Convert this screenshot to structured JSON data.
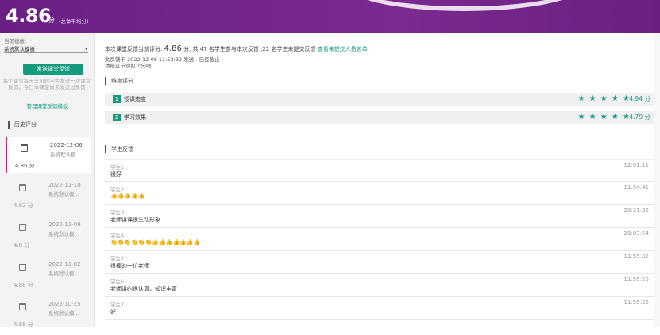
{
  "header": {
    "score": "4.86",
    "unit": "分",
    "subtitle": "(总体平均分)"
  },
  "sidebar": {
    "template_label": "当前模板:",
    "template_value": "系统默认模板",
    "send_button": "发送课堂反馈",
    "hint": "每个课堂每天只可给学生发送一次课堂反馈，今日本课堂尚未发送过反馈",
    "manage_link": "管理课堂反馈模板",
    "history_title": "历史评分",
    "history": [
      {
        "date": "2022-12-06",
        "template": "系统默认模...",
        "score": "4.86 分",
        "active": true
      },
      {
        "date": "2022-11-10",
        "template": "系统默认模...",
        "score": "4.82 分",
        "active": false
      },
      {
        "date": "2022-11-09",
        "template": "系统默认模...",
        "score": "4.8 分",
        "active": false
      },
      {
        "date": "2022-11-02",
        "template": "系统默认模...",
        "score": "4.88 分",
        "active": false
      },
      {
        "date": "2022-10-25",
        "template": "系统默认模...",
        "score": "4.88 分",
        "active": false
      }
    ]
  },
  "main": {
    "summary_prefix": "本次课堂反馈当前评分:",
    "summary_score": "4.86",
    "summary_suffix": "分, 共 47 名学生参与本次反馈 ,22 名学生未提交反馈",
    "view_link": "查看未提交人员名单",
    "sent_line1": "此反馈于 2022-12-06 11:53:32 发送，已经截止",
    "sent_line2": "请给这节课打个分吧",
    "dim_title": "维度评分",
    "dimensions": [
      {
        "no": "1",
        "name": "授课态度",
        "stars": "★ ★ ★ ★ ★",
        "value": "4.94 分"
      },
      {
        "no": "2",
        "name": "学习效果",
        "stars": "★ ★ ★ ★ ★",
        "value": "4.79 分"
      }
    ],
    "feedback_title": "学生反馈",
    "feedback": [
      {
        "who": "学生1 :",
        "text": "很好",
        "time": "12:01:11"
      },
      {
        "who": "学生2 :",
        "text": "👍👍👍👍👍",
        "time": "11:54:41"
      },
      {
        "who": "学生3 :",
        "text": "老师讲课很生动形象",
        "time": "20:21:32"
      },
      {
        "who": "学生4 :",
        "text": "👏👏👏👏👏👏👍👍👍👍👍👍👍",
        "time": "20:03:54"
      },
      {
        "who": "学生5 :",
        "text": "很棒的一位老师",
        "time": "11:55:32"
      },
      {
        "who": "学生6 :",
        "text": "老师讲的很认真，知识丰富",
        "time": "11:55:59"
      },
      {
        "who": "学生7 :",
        "text": "好",
        "time": "11:55:22"
      }
    ]
  },
  "colors": {
    "brand": "#6a1f86",
    "accent": "#149b7e",
    "active_marker": "#d9246c"
  }
}
